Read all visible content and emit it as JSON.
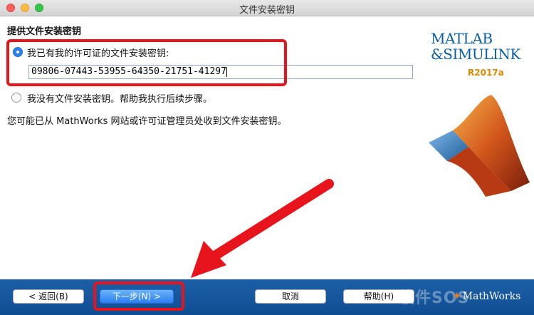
{
  "window": {
    "title": "文件安装密钥"
  },
  "section": {
    "title": "提供文件安装密钥"
  },
  "options": {
    "have_key": {
      "label": "我已有我的许可证的文件安装密钥:",
      "selected": true
    },
    "no_key": {
      "label": "我没有文件安装密钥。帮助我执行后续步骤。",
      "selected": false
    }
  },
  "key_input": {
    "value": "09806-07443-53955-64350-21751-41297"
  },
  "hint": "您可能已从 MathWorks 网站或许可证管理员处收到文件安装密钥。",
  "logo": {
    "line1": "MATLAB",
    "line2": "&SIMULINK",
    "version": "R2017a"
  },
  "buttons": {
    "back": "< 返回(B)",
    "next": "下一步(N) >",
    "cancel": "取消",
    "help": "帮助(H)"
  },
  "footer": {
    "watermark": "软件SOS",
    "brand": "MathWorks"
  },
  "colors": {
    "highlight": "#e8141c",
    "footer": "#1c5fa6",
    "radio_accent": "#2f7ff0"
  },
  "icons": [
    "close-icon",
    "minimize-icon",
    "maximize-icon",
    "radio-selected-icon",
    "radio-unselected-icon",
    "matlab-membrane-icon",
    "red-arrow-icon"
  ]
}
